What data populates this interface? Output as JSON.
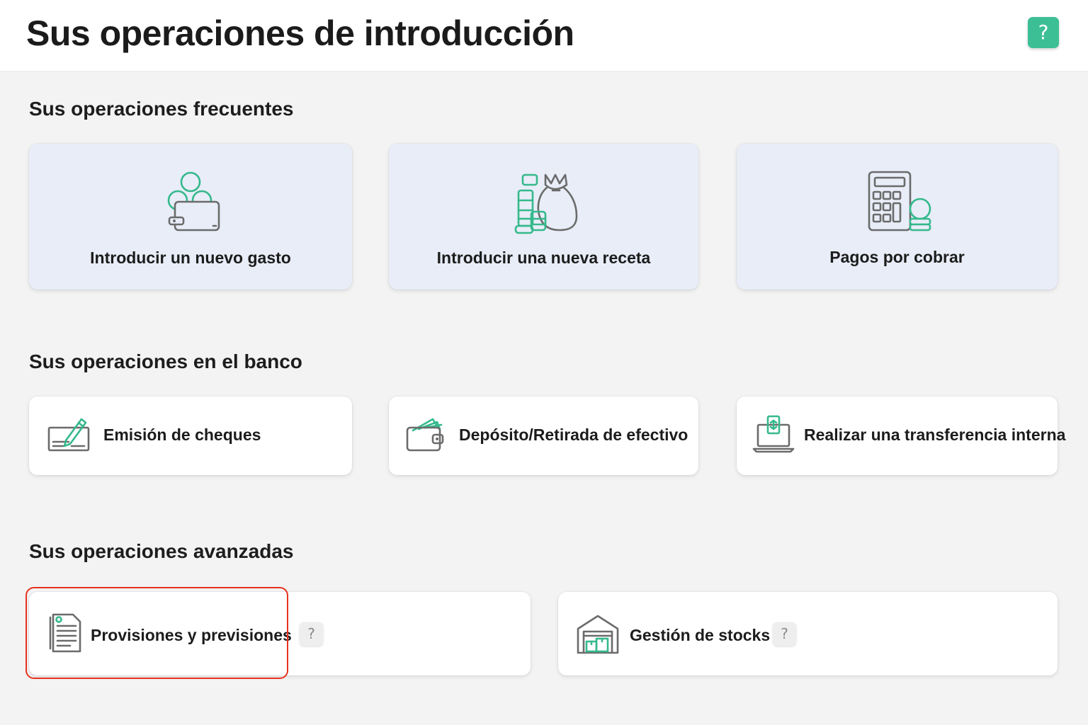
{
  "header": {
    "title": "Sus operaciones de introducción",
    "help_label": "?"
  },
  "frequent": {
    "title": "Sus operaciones frecuentes",
    "items": [
      {
        "label": "Introducir un nuevo gasto",
        "icon": "wallet-coins-icon"
      },
      {
        "label": "Introducir una nueva receta",
        "icon": "money-bag-coins-icon"
      },
      {
        "label": "Pagos por cobrar",
        "icon": "calculator-coins-icon"
      }
    ]
  },
  "bank": {
    "title": "Sus operaciones en el banco",
    "items": [
      {
        "label": "Emisión de cheques",
        "icon": "check-pen-icon"
      },
      {
        "label": "Depósito/Retirada de efectivo",
        "icon": "wallet-cash-icon"
      },
      {
        "label": "Realizar una transferencia interna",
        "icon": "laptop-transfer-icon"
      }
    ]
  },
  "advanced": {
    "title": "Sus operaciones avanzadas",
    "items": [
      {
        "label": "Provisiones y previsiones",
        "icon": "document-list-icon",
        "help_label": "?",
        "highlighted": true
      },
      {
        "label": "Gestión de stocks",
        "icon": "warehouse-icon",
        "help_label": "?"
      }
    ]
  },
  "colors": {
    "accent": "#3dbf96",
    "icon_gray": "#6b6b6b",
    "highlight": "#e8321e",
    "frequent_card_bg": "#e8edf8"
  }
}
